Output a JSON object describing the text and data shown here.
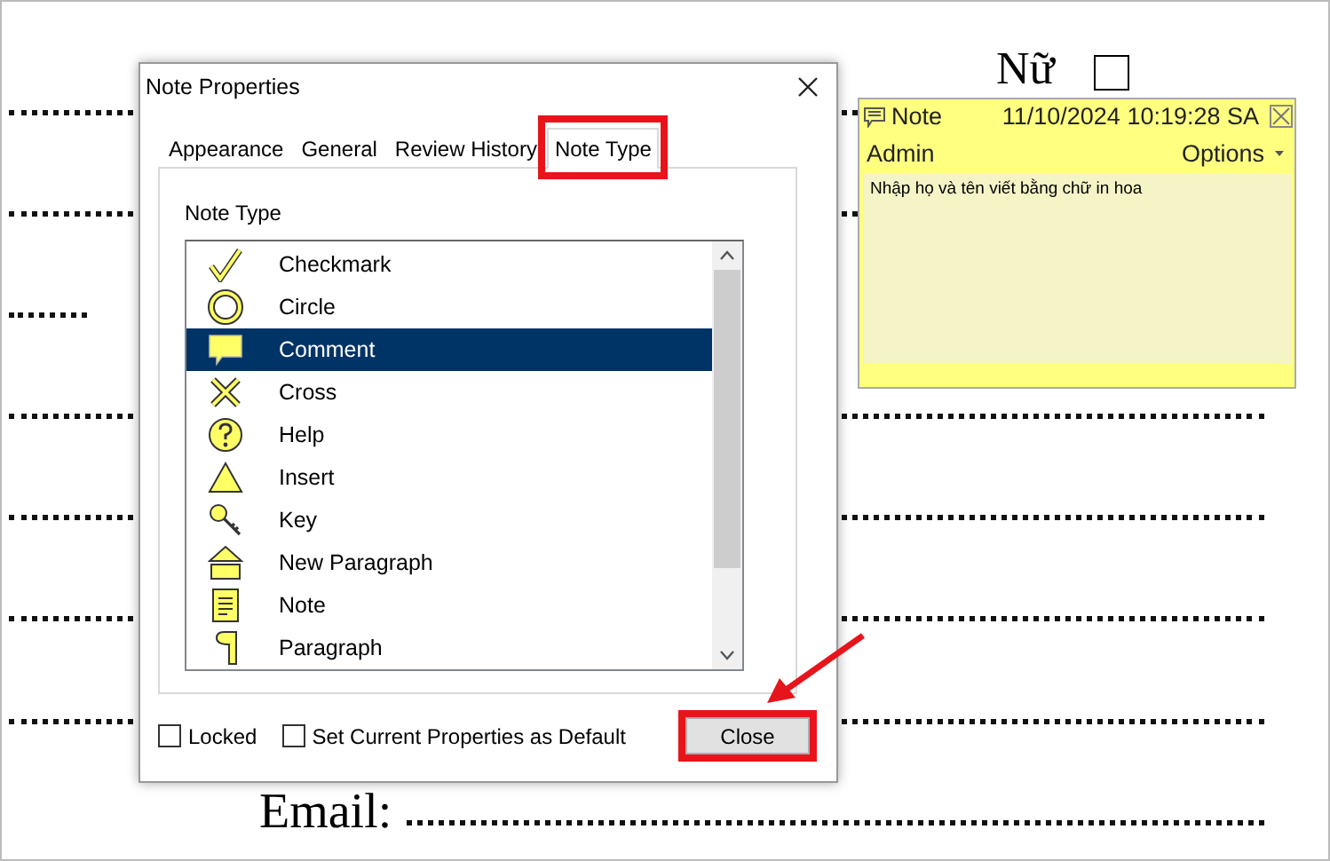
{
  "document": {
    "gender_label": "Nữ",
    "gender_checked": false,
    "email_label": "Email:"
  },
  "dialog": {
    "title": "Note Properties",
    "tabs": [
      {
        "label": "Appearance",
        "selected": false
      },
      {
        "label": "General",
        "selected": false
      },
      {
        "label": "Review History",
        "selected": false
      },
      {
        "label": "Note Type",
        "selected": true
      }
    ],
    "group_label": "Note Type",
    "note_types": [
      {
        "kind": "checkmark",
        "label": "Checkmark",
        "selected": false
      },
      {
        "kind": "circle",
        "label": "Circle",
        "selected": false
      },
      {
        "kind": "comment",
        "label": "Comment",
        "selected": true
      },
      {
        "kind": "cross",
        "label": "Cross",
        "selected": false
      },
      {
        "kind": "help",
        "label": "Help",
        "selected": false
      },
      {
        "kind": "insert",
        "label": "Insert",
        "selected": false
      },
      {
        "kind": "key",
        "label": "Key",
        "selected": false
      },
      {
        "kind": "new_paragraph",
        "label": "New Paragraph",
        "selected": false
      },
      {
        "kind": "note",
        "label": "Note",
        "selected": false
      },
      {
        "kind": "paragraph",
        "label": "Paragraph",
        "selected": false
      }
    ],
    "checkboxes": [
      {
        "label": "Locked",
        "checked": false
      },
      {
        "label": "Set Current Properties as Default",
        "checked": false
      }
    ],
    "close_button": "Close"
  },
  "note": {
    "title": "Note",
    "timestamp": "11/10/2024 10:19:28 SA",
    "author": "Admin",
    "options": "Options",
    "body": "Nhập họ và tên viết bằng chữ in hoa"
  }
}
